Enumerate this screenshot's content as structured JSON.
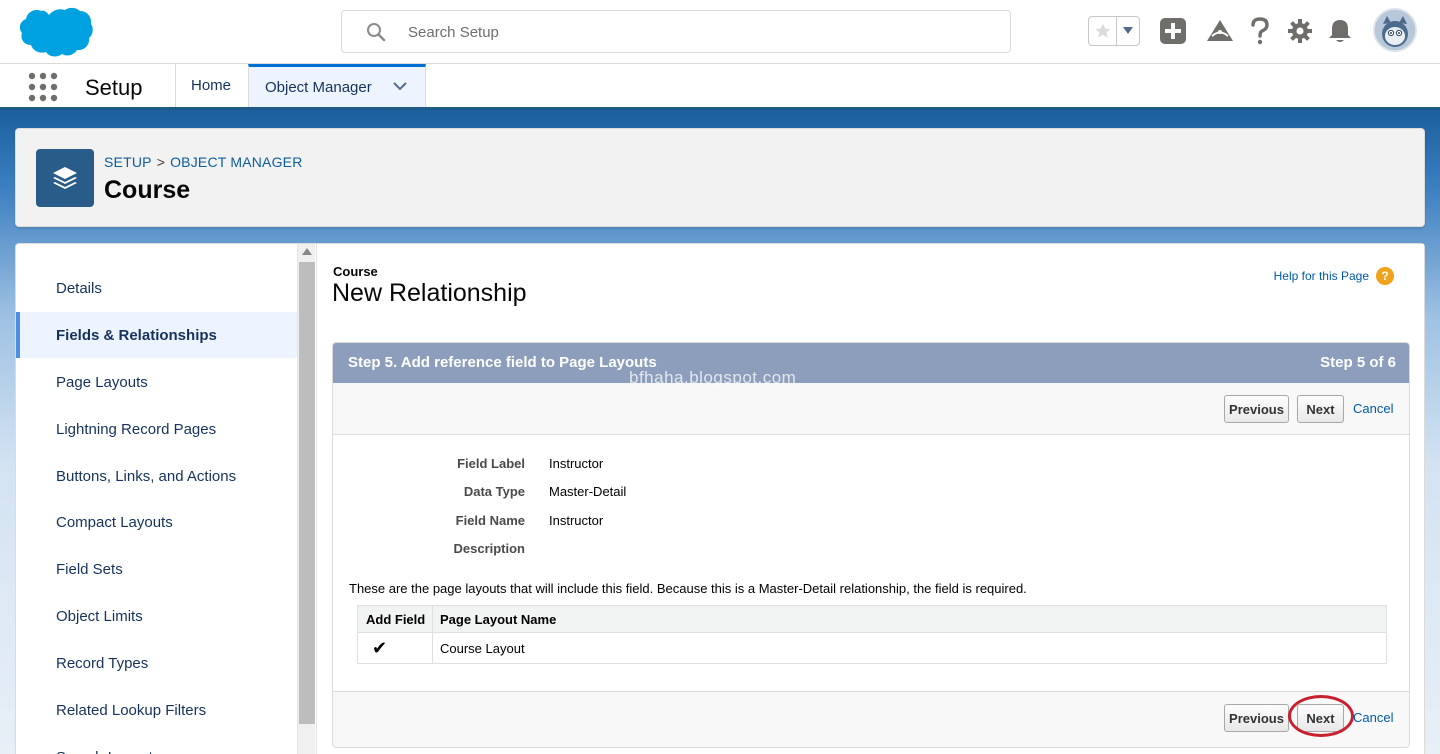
{
  "header": {
    "search_placeholder": "Search Setup",
    "icons": [
      "salesforce-cloud-logo",
      "search-icon",
      "favorites-star-icon",
      "favorites-dropdown-icon",
      "global-actions-plus-icon",
      "trailhead-icon",
      "help-icon",
      "setup-gear-icon",
      "notifications-bell-icon",
      "user-avatar"
    ]
  },
  "nav": {
    "app_name": "Setup",
    "tabs": [
      {
        "label": "Home"
      },
      {
        "label": "Object Manager"
      }
    ]
  },
  "object_header": {
    "breadcrumb_setup": "SETUP",
    "breadcrumb_sep": ">",
    "breadcrumb_om": "OBJECT MANAGER",
    "title": "Course"
  },
  "sidebar": {
    "items": [
      {
        "label": "Details"
      },
      {
        "label": "Fields & Relationships",
        "active": true
      },
      {
        "label": "Page Layouts"
      },
      {
        "label": "Lightning Record Pages"
      },
      {
        "label": "Buttons, Links, and Actions"
      },
      {
        "label": "Compact Layouts"
      },
      {
        "label": "Field Sets"
      },
      {
        "label": "Object Limits"
      },
      {
        "label": "Record Types"
      },
      {
        "label": "Related Lookup Filters"
      },
      {
        "label": "Search Layouts"
      }
    ]
  },
  "content": {
    "object_label": "Course",
    "page_title": "New Relationship",
    "help_link": "Help for this Page",
    "help_icon": "?",
    "step_title": "Step 5. Add reference field to Page Layouts",
    "step_counter": "Step 5 of 6",
    "watermark": "bfhaha.blogspot.com",
    "buttons": {
      "previous": "Previous",
      "next": "Next",
      "cancel": "Cancel"
    },
    "fields": [
      {
        "label": "Field Label",
        "value": "Instructor"
      },
      {
        "label": "Data Type",
        "value": "Master-Detail"
      },
      {
        "label": "Field Name",
        "value": "Instructor"
      },
      {
        "label": "Description",
        "value": ""
      }
    ],
    "info_text": "These are the page layouts that will include this field. Because this is a Master-Detail relationship, the field is required.",
    "table": {
      "headers": [
        "Add Field",
        "Page Layout Name"
      ],
      "rows": [
        {
          "checked": "✔",
          "name": "Course Layout"
        }
      ]
    }
  },
  "colors": {
    "brand_blue": "#0070d2",
    "step_header": "#8d9ebc",
    "highlight_oval": "#c8202f",
    "help_orange": "#f0a31d"
  }
}
